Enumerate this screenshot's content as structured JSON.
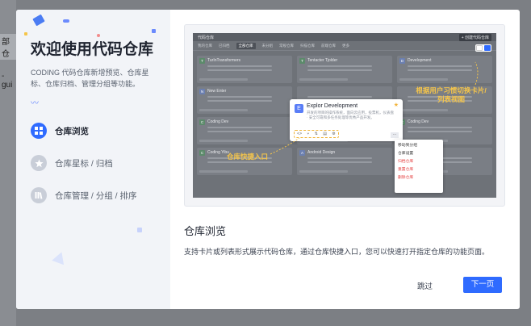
{
  "background": {
    "fragment_1": "部仓",
    "fragment_2": "-gui"
  },
  "left_panel": {
    "title": "欢迎使用代码仓库",
    "description": "CODING 代码仓库新增预览、仓库星标、仓库归档、管理分组等功能。",
    "nav": [
      {
        "label": "仓库浏览",
        "icon": "grid-icon",
        "active": true
      },
      {
        "label": "仓库星标 / 归档",
        "icon": "star-icon",
        "active": false
      },
      {
        "label": "仓库管理 / 分组 / 排序",
        "icon": "books-icon",
        "active": false
      }
    ]
  },
  "preview": {
    "header_title": "代码仓库",
    "header_button": "+ 创建代码仓库",
    "tabs": [
      "我的仓库",
      "已归档",
      "全部仓库",
      "未分组",
      "常规仓库",
      "扫描仓库",
      "前端仓库",
      "更多"
    ],
    "active_tab": "全部仓库",
    "cards": [
      {
        "name": "TurInTransformers",
        "initial": "T",
        "color": "#5c8a6b"
      },
      {
        "name": "Tentacter Tjolder",
        "initial": "T",
        "color": "#5c8a6b"
      },
      {
        "name": "Development",
        "initial": "D",
        "color": "#6b7fb0"
      },
      {
        "name": "New Enter",
        "initial": "N",
        "color": "#6b7fb0"
      },
      {
        "name": "",
        "initial": "",
        "color": "#7a7e85"
      },
      {
        "name": "",
        "initial": "",
        "color": "#7a7e85"
      },
      {
        "name": "Coding Dev",
        "initial": "C",
        "color": "#5c8a6b"
      },
      {
        "name": "Un Android Design",
        "initial": "U",
        "color": "#6b7fb0"
      },
      {
        "name": "Coding Dev",
        "initial": "C",
        "color": "#5c8a6b"
      },
      {
        "name": "Coding Yibu",
        "initial": "C",
        "color": "#5c8a6b"
      },
      {
        "name": "Android Design",
        "initial": "A",
        "color": "#6b7fb0"
      },
      {
        "name": "",
        "initial": "",
        "color": "#7a7e85"
      }
    ],
    "popup": {
      "initial": "E",
      "name": "Explor Development",
      "description": "开发的项目的操作系统，面向云应用，投票机，仪表盘 · 安全可靠和多任务处理等优秀产品开发。"
    },
    "menu": [
      "移动到分组",
      "仓库设置",
      "归档仓库",
      "重置仓库",
      "删除仓库"
    ],
    "annotation_quick": "仓库快捷入口",
    "annotation_view": "根据用户习惯切换卡片/列表视图"
  },
  "right_panel": {
    "title": "仓库浏览",
    "description": "支持卡片或列表形式展示代码仓库，通过仓库快捷入口，您可以快速打开指定仓库的功能页面。",
    "skip_label": "跳过",
    "next_label": "下一页"
  },
  "colors": {
    "accent": "#2f6bff",
    "annotation": "#f5c54a"
  }
}
